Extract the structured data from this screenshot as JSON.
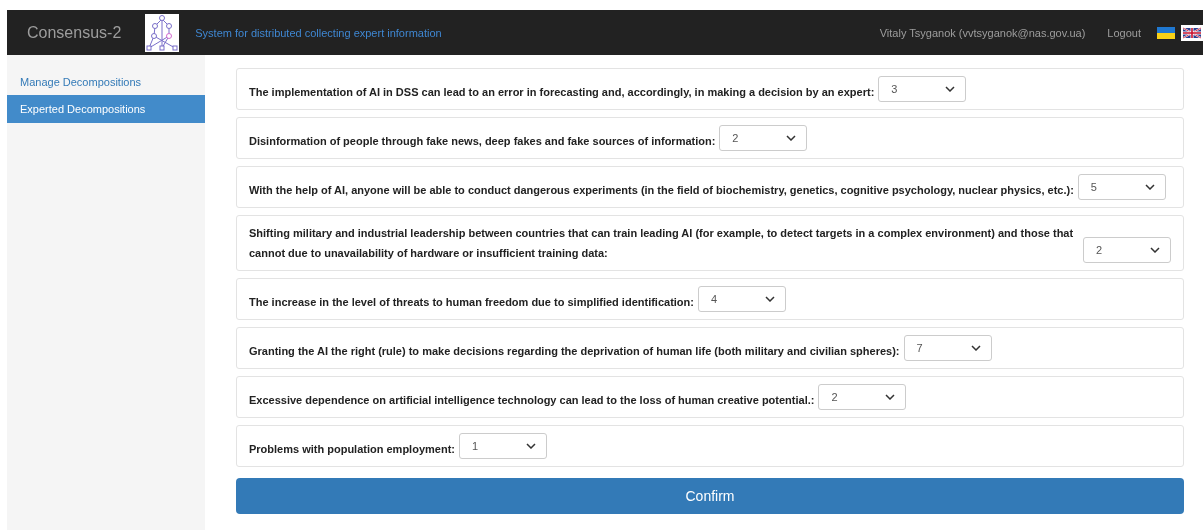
{
  "navbar": {
    "brand": "Consensus-2",
    "tagline": "System for distributed collecting expert information",
    "user": "Vitaly Tsyganok (vvtsyganok@nas.gov.ua)",
    "logout": "Logout"
  },
  "sidebar": {
    "items": [
      {
        "label": "Manage Decompositions",
        "selected": false
      },
      {
        "label": "Experted Decompositions",
        "selected": true
      }
    ]
  },
  "questions": [
    {
      "text": "The implementation of AI in DSS can lead to an error in forecasting and, accordingly, in making a decision by an expert:",
      "value": "3"
    },
    {
      "text": "Disinformation of people through fake news, deep fakes and fake sources of information:",
      "value": "2"
    },
    {
      "text": "With the help of AI, anyone will be able to conduct dangerous experiments (in the field of biochemistry, genetics, cognitive psychology, nuclear physics, etc.):",
      "value": "5"
    },
    {
      "text": "Shifting military and industrial leadership between countries that can train leading AI (for example, to detect targets in a complex environment) and those that cannot due to unavailability of hardware or insufficient training data:",
      "value": "2"
    },
    {
      "text": "The increase in the level of threats to human freedom due to simplified identification:",
      "value": "4"
    },
    {
      "text": "Granting the AI the right (rule) to make decisions regarding the deprivation of human life (both military and civilian spheres):",
      "value": "7"
    },
    {
      "text": "Excessive dependence on artificial intelligence technology can lead to the loss of human creative potential.:",
      "value": "2"
    },
    {
      "text": "Problems with population employment:",
      "value": "1"
    }
  ],
  "confirm": "Confirm"
}
